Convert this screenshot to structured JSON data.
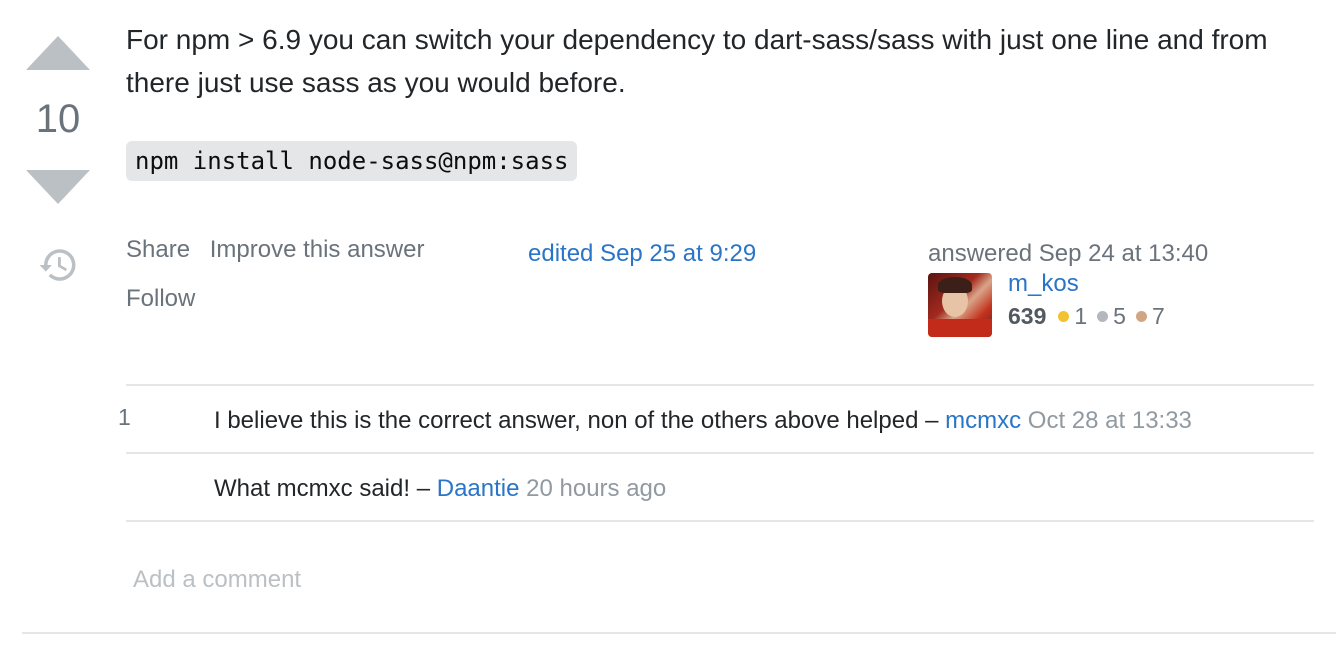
{
  "vote": {
    "count": "10",
    "upvote_icon": "arrow-up-icon",
    "downvote_icon": "arrow-down-icon",
    "history_icon": "history-icon"
  },
  "post": {
    "text": "For npm > 6.9 you can switch your dependency to dart-sass/sass with just one line and from there just use sass as you would before.",
    "code": "npm install node-sass@npm:sass"
  },
  "menu": {
    "share": "Share",
    "improve": "Improve this answer",
    "follow": "Follow"
  },
  "edited": {
    "label": "edited Sep 25 at 9:29"
  },
  "user": {
    "action_time": "answered Sep 24 at 13:40",
    "name": "m_kos",
    "reputation": "639",
    "badges": {
      "gold": "1",
      "silver": "5",
      "bronze": "7"
    },
    "colors": {
      "gold": "#f1c232",
      "silver": "#b4b8bc",
      "bronze": "#d1a684"
    }
  },
  "comments": [
    {
      "score": "1",
      "text": "I believe this is the correct answer, non of the others above helped",
      "separator": "–",
      "user": "mcmxc",
      "date": "Oct 28 at 13:33"
    },
    {
      "score": "",
      "text": "What mcmxc said!",
      "separator": "–",
      "user": "Daantie",
      "date": "20 hours ago"
    }
  ],
  "add_comment": "Add a comment",
  "theme": {
    "link": "#2a75c8",
    "muted": "#6a737c",
    "vote_arrow": "#bbc0c4"
  }
}
